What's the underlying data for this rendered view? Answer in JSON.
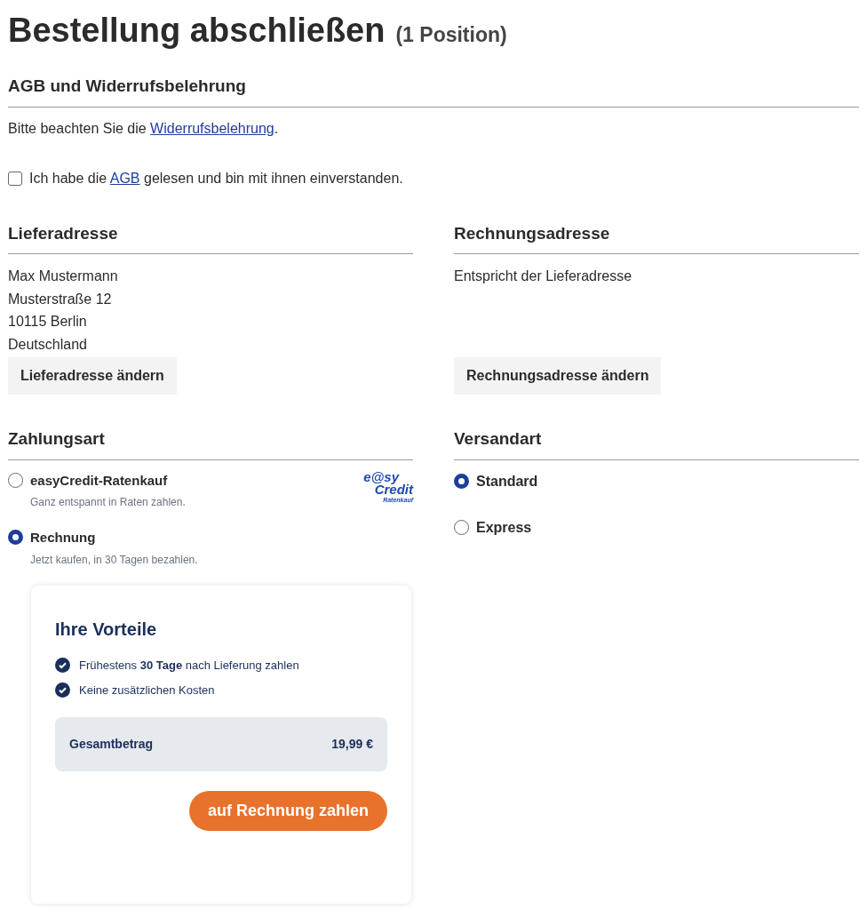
{
  "title": "Bestellung abschließen",
  "title_count": "(1 Position)",
  "terms": {
    "heading": "AGB und Widerrufsbelehrung",
    "notice_before": "Bitte beachten Sie die ",
    "notice_link": "Widerrufsbelehrung",
    "notice_after": ".",
    "agree_before": "Ich habe die ",
    "agree_link": "AGB",
    "agree_after": " gelesen und bin mit ihnen einverstanden.",
    "checked": false
  },
  "delivery_address": {
    "heading": "Lieferadresse",
    "lines": [
      "Max Mustermann",
      "Musterstraße 12",
      "10115 Berlin",
      "Deutschland"
    ],
    "button": "Lieferadresse ändern"
  },
  "billing_address": {
    "heading": "Rechnungsadresse",
    "lines": [
      "Entspricht der Lieferadresse"
    ],
    "button": "Rechnungsadresse ändern"
  },
  "payment": {
    "heading": "Zahlungsart",
    "options": [
      {
        "label": "easyCredit-Ratenkauf",
        "description": "Ganz entspannt in Raten zahlen.",
        "selected": false,
        "logo": [
          "e@sy",
          "Credit",
          "Ratenkauf"
        ]
      },
      {
        "label": "Rechnung",
        "description": "Jetzt kaufen, in 30 Tagen bezahlen.",
        "selected": true
      }
    ]
  },
  "shipping": {
    "heading": "Versandart",
    "options": [
      {
        "label": "Standard",
        "selected": true
      },
      {
        "label": "Express",
        "selected": false
      }
    ]
  },
  "benefits": {
    "heading": "Ihre Vorteile",
    "items": [
      "Frühestens **30 Tage** nach Lieferung zahlen",
      "Keine zusätzlichen Kosten"
    ],
    "total_label": "Gesamtbetrag",
    "total_value": "19,99 €",
    "button": "auf Rechnung zahlen"
  }
}
